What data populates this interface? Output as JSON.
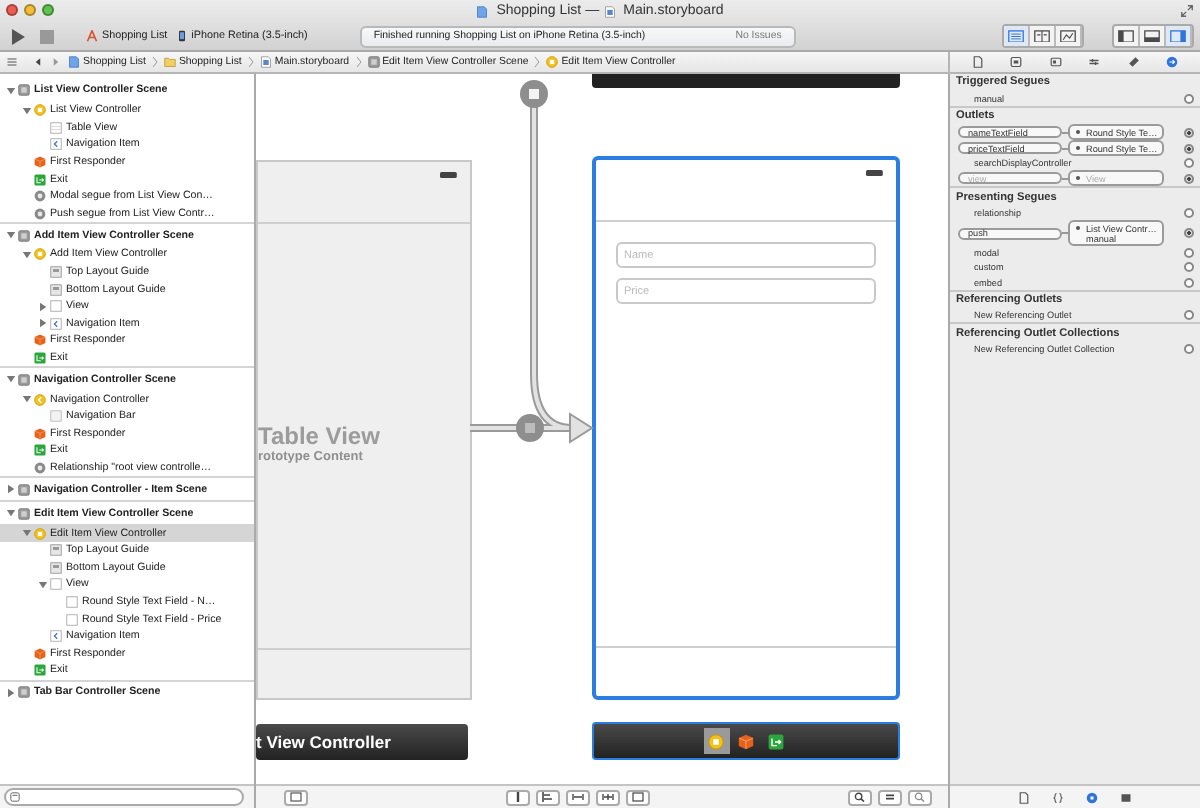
{
  "window": {
    "title": "Shopping List",
    "separator": "—",
    "document": "Main.storyboard"
  },
  "toolbar": {
    "scheme": "Shopping List",
    "destination": "iPhone Retina (3.5-inch)",
    "status": "Finished running Shopping List on iPhone Retina (3.5-inch)",
    "issues": "No Issues",
    "editor_buttons": [
      {
        "kind": "standard",
        "selected": true
      },
      {
        "kind": "assistant",
        "selected": false
      },
      {
        "kind": "version",
        "selected": false
      }
    ],
    "view_buttons": [
      {
        "kind": "navigator",
        "selected": false
      },
      {
        "kind": "debug",
        "selected": false
      },
      {
        "kind": "utilities",
        "selected": true
      }
    ]
  },
  "jump_bar": [
    {
      "label": "Shopping List",
      "kind": "project"
    },
    {
      "label": "Shopping List",
      "kind": "folder"
    },
    {
      "label": "Main.storyboard",
      "kind": "storyboard"
    },
    {
      "label": "Edit Item View Controller Scene",
      "kind": "scene"
    },
    {
      "label": "Edit Item View Controller",
      "kind": "controller"
    }
  ],
  "navigator": {
    "tree": [
      {
        "label": "List View Controller Scene",
        "kind": "scene",
        "expanded": true,
        "selected": false,
        "children": [
          {
            "label": "List View Controller",
            "kind": "controller",
            "expanded": true,
            "selected": false,
            "children": [
              {
                "label": "Table View",
                "kind": "table",
                "selected": false
              },
              {
                "label": "Navigation Item",
                "kind": "nav-item",
                "selected": false
              }
            ]
          },
          {
            "label": "First Responder",
            "kind": "responder",
            "selected": false
          },
          {
            "label": "Exit",
            "kind": "exit",
            "selected": false
          },
          {
            "label": "Modal segue from List View Con…",
            "kind": "segue",
            "selected": false
          },
          {
            "label": "Push segue from List View Contr…",
            "kind": "segue",
            "selected": false
          }
        ]
      },
      {
        "label": "Add Item View Controller Scene",
        "kind": "scene",
        "expanded": true,
        "selected": false,
        "children": [
          {
            "label": "Add Item View Controller",
            "kind": "controller",
            "expanded": true,
            "selected": false,
            "children": [
              {
                "label": "Top Layout Guide",
                "kind": "guide",
                "selected": false
              },
              {
                "label": "Bottom Layout Guide",
                "kind": "guide",
                "selected": false
              },
              {
                "label": "View",
                "kind": "view",
                "expanded": false,
                "selected": false
              },
              {
                "label": "Navigation Item",
                "kind": "nav-item",
                "expanded": false,
                "selected": false
              }
            ]
          },
          {
            "label": "First Responder",
            "kind": "responder",
            "selected": false
          },
          {
            "label": "Exit",
            "kind": "exit",
            "selected": false
          }
        ]
      },
      {
        "label": "Navigation Controller Scene",
        "kind": "scene",
        "expanded": true,
        "selected": false,
        "children": [
          {
            "label": "Navigation Controller",
            "kind": "nav-controller",
            "expanded": true,
            "selected": false,
            "children": [
              {
                "label": "Navigation Bar",
                "kind": "nav-bar",
                "selected": false
              }
            ]
          },
          {
            "label": "First Responder",
            "kind": "responder",
            "selected": false
          },
          {
            "label": "Exit",
            "kind": "exit",
            "selected": false
          },
          {
            "label": "Relationship \"root view controlle…",
            "kind": "segue",
            "selected": false
          }
        ]
      },
      {
        "label": "Navigation Controller - Item Scene",
        "kind": "scene",
        "expanded": false,
        "selected": false
      },
      {
        "label": "Edit Item View Controller Scene",
        "kind": "scene",
        "expanded": true,
        "selected": false,
        "children": [
          {
            "label": "Edit Item View Controller",
            "kind": "controller",
            "expanded": true,
            "selected": true,
            "children": [
              {
                "label": "Top Layout Guide",
                "kind": "guide",
                "selected": false
              },
              {
                "label": "Bottom Layout Guide",
                "kind": "guide",
                "selected": false
              },
              {
                "label": "View",
                "kind": "view",
                "expanded": true,
                "selected": false,
                "children": [
                  {
                    "label": "Round Style Text Field - N…",
                    "kind": "field",
                    "selected": false
                  },
                  {
                    "label": "Round Style Text Field - Price",
                    "kind": "field",
                    "selected": false
                  }
                ]
              },
              {
                "label": "Navigation Item",
                "kind": "nav-item",
                "selected": false
              }
            ]
          },
          {
            "label": "First Responder",
            "kind": "responder",
            "selected": false
          },
          {
            "label": "Exit",
            "kind": "exit",
            "selected": false
          }
        ]
      },
      {
        "label": "Tab Bar Controller Scene",
        "kind": "scene",
        "expanded": false,
        "selected": false
      }
    ]
  },
  "canvas": {
    "table_scene": {
      "title": "Table View",
      "subtitle": "rototype Content",
      "dock_title": "t View Controller"
    },
    "edit_scene": {
      "selected": true,
      "fields": [
        {
          "placeholder": "Name"
        },
        {
          "placeholder": "Price"
        }
      ],
      "dock": [
        {
          "kind": "controller",
          "selected": true
        },
        {
          "kind": "responder",
          "selected": false
        },
        {
          "kind": "exit",
          "selected": false
        }
      ]
    }
  },
  "inspector": {
    "tabs": [
      {
        "kind": "file",
        "selected": false
      },
      {
        "kind": "help",
        "selected": false
      },
      {
        "kind": "identity",
        "selected": false
      },
      {
        "kind": "attributes",
        "selected": false
      },
      {
        "kind": "size",
        "selected": false
      },
      {
        "kind": "connections",
        "selected": true
      }
    ],
    "sections": [
      {
        "title": "Triggered Segues",
        "rows": [
          {
            "label": "manual",
            "connected": false,
            "disabled": false
          }
        ]
      },
      {
        "title": "Outlets",
        "rows": [
          {
            "label": "nameTextField",
            "connected": true,
            "disabled": false,
            "target": "Round Style Te…"
          },
          {
            "label": "priceTextField",
            "connected": true,
            "disabled": false,
            "target": "Round Style Te…"
          },
          {
            "label": "searchDisplayController",
            "connected": false,
            "disabled": false
          },
          {
            "label": "view",
            "connected": true,
            "disabled": true,
            "target": "View"
          }
        ]
      },
      {
        "title": "Presenting Segues",
        "rows": [
          {
            "label": "relationship",
            "connected": false,
            "disabled": false
          },
          {
            "label": "push",
            "connected": true,
            "disabled": false,
            "target": "List View Contr…",
            "target_detail": "manual"
          },
          {
            "label": "modal",
            "connected": false,
            "disabled": false
          },
          {
            "label": "custom",
            "connected": false,
            "disabled": false
          },
          {
            "label": "embed",
            "connected": false,
            "disabled": false
          }
        ]
      },
      {
        "title": "Referencing Outlets",
        "rows": [
          {
            "label": "New Referencing Outlet",
            "connected": false,
            "disabled": false
          }
        ]
      },
      {
        "title": "Referencing Outlet Collections",
        "rows": [
          {
            "label": "New Referencing Outlet Collection",
            "connected": false,
            "disabled": false
          }
        ]
      }
    ],
    "library_tabs": [
      {
        "kind": "file",
        "selected": false
      },
      {
        "kind": "code",
        "selected": false
      },
      {
        "kind": "object",
        "selected": true
      },
      {
        "kind": "media",
        "selected": false
      }
    ]
  }
}
